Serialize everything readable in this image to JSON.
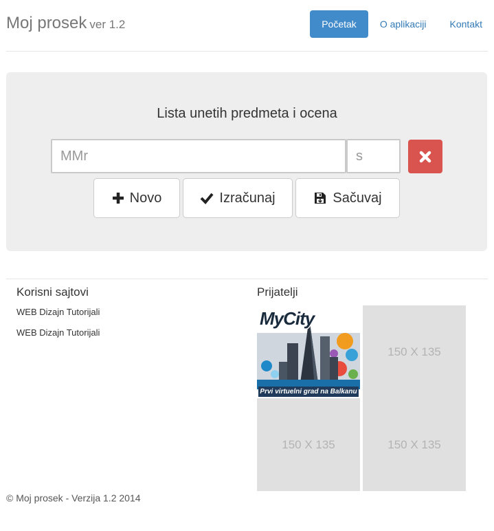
{
  "header": {
    "brand": "Moj prosek",
    "version": "ver 1.2",
    "nav": [
      "Početak",
      "O aplikaciji",
      "Kontakt"
    ]
  },
  "main": {
    "heading": "Lista unetih predmeta i ocena",
    "subject_placeholder": "MMr",
    "grade_placeholder": "s",
    "buttons": {
      "new": "Novo",
      "calculate": "Izračunaj",
      "save": "Sačuvaj"
    }
  },
  "useful_sites": {
    "title": "Korisni sajtovi",
    "links": [
      "WEB Dizajn Tutorijali",
      "WEB Dizajn Tutorijali"
    ]
  },
  "friends": {
    "title": "Prijatelji",
    "banner": {
      "logo_text": "MyCity",
      "caption": "Prvi virtuelni grad na Balkanu"
    },
    "placeholder_text": "150 X 135"
  },
  "footer": {
    "text": "© Moj prosek - Verzija 1.2 2014"
  },
  "colors": {
    "primary": "#428bca",
    "danger": "#d9534f",
    "jumbotron": "#eeeeee"
  }
}
